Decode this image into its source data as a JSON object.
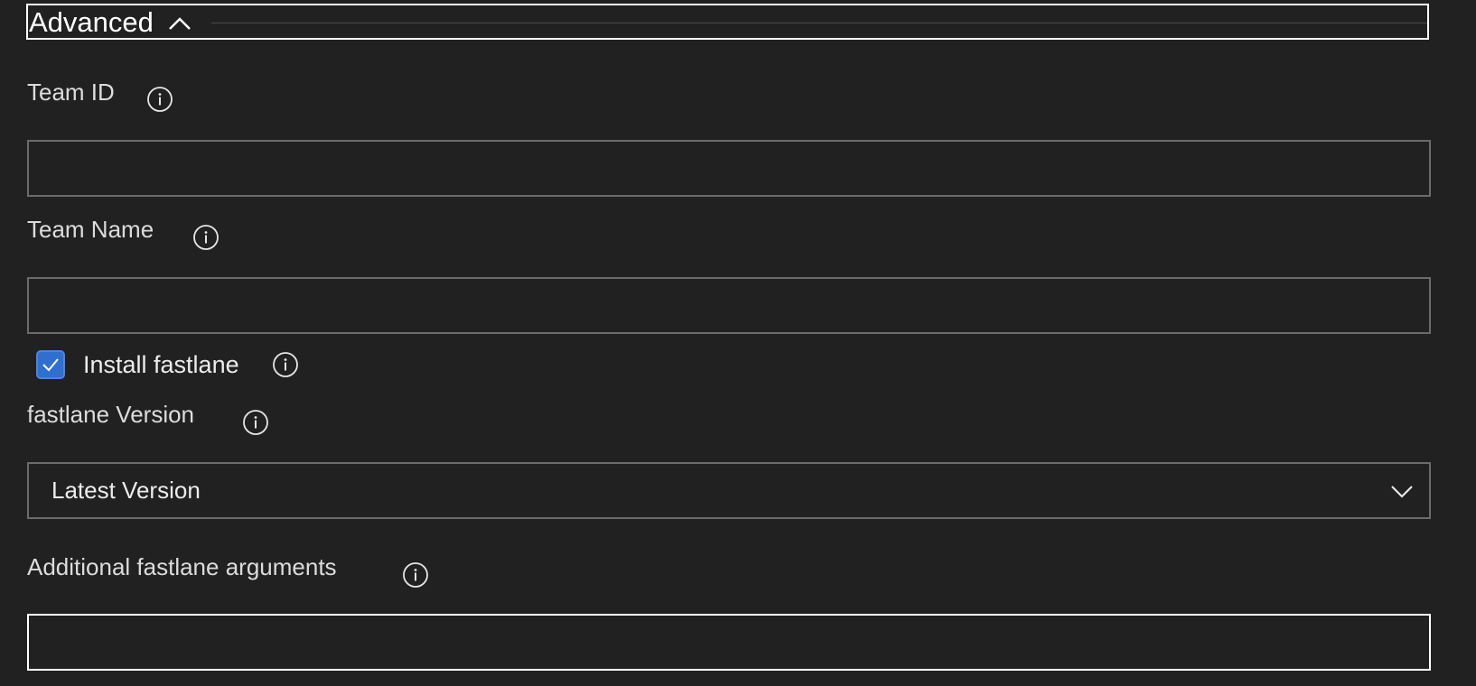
{
  "section": {
    "title": "Advanced",
    "toggle_icon": "chevron-up-icon"
  },
  "fields": {
    "team_id": {
      "label": "Team ID",
      "value": "",
      "info_icon": "info-icon"
    },
    "team_name": {
      "label": "Team Name",
      "value": "",
      "info_icon": "info-icon"
    },
    "install_fastlane": {
      "label": "Install fastlane",
      "checked": true,
      "info_icon": "info-icon"
    },
    "fastlane_version": {
      "label": "fastlane Version",
      "selected": "Latest Version",
      "dropdown_icon": "chevron-down-icon",
      "info_icon": "info-icon"
    },
    "additional_arguments": {
      "label": "Additional fastlane arguments",
      "value": "",
      "info_icon": "info-icon"
    }
  },
  "colors": {
    "background": "#212121",
    "border": "#6b6b6b",
    "focus_border": "#ffffff",
    "checkbox_accent": "#2f6fd0",
    "text": "#e6e6e6"
  }
}
